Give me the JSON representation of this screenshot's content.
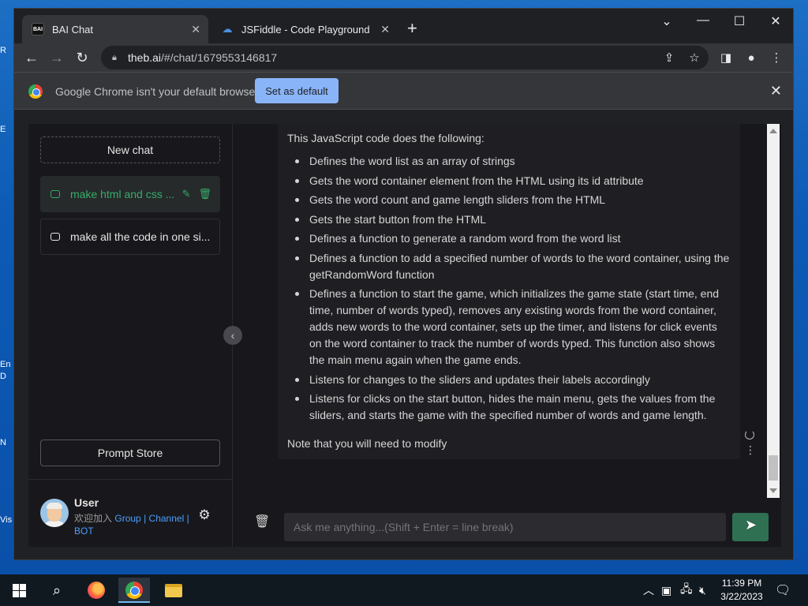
{
  "desktop": {
    "icon_letters": [
      "R",
      "E",
      "En",
      "D",
      "N",
      "Vis"
    ]
  },
  "browser": {
    "tabs": [
      {
        "title": "BAI Chat",
        "favicon_text": "BAI",
        "active": true
      },
      {
        "title": "JSFiddle - Code Playground",
        "active": false
      }
    ],
    "new_tab_symbol": "+",
    "controls": {
      "minimize": "—",
      "maximize": "☐",
      "close": "✕",
      "tab_search": "⌄"
    },
    "url_host": "theb.ai",
    "url_path": "/#/chat/1679553146817",
    "infobar": {
      "message": "Google Chrome isn't your default browser",
      "button": "Set as default"
    }
  },
  "sidebar": {
    "new_chat_label": "New chat",
    "chats": [
      {
        "title": "make html and css ...",
        "active": true
      },
      {
        "title": "make all the code in one si...",
        "active": false
      }
    ],
    "prompt_store_label": "Prompt Store",
    "user": {
      "name": "User",
      "tagline_prefix": "欢迎加入",
      "links": [
        "Group",
        "Channel",
        "BOT"
      ],
      "separator": "|"
    }
  },
  "message": {
    "intro": "This JavaScript code does the following:",
    "bullets": [
      "Defines the word list as an array of strings",
      "Gets the word container element from the HTML using its id attribute",
      "Gets the word count and game length sliders from the HTML",
      "Gets the start button from the HTML",
      "Defines a function to generate a random word from the word list",
      "Defines a function to add a specified number of words to the word container, using the getRandomWord function",
      "Defines a function to start the game, which initializes the game state (start time, end time, number of words typed), removes any existing words from the word container, adds new words to the word container, sets up the timer, and listens for click events on the word container to track the number of words typed. This function also shows the main menu again when the game ends.",
      "Listens for changes to the sliders and updates their labels accordingly",
      "Listens for clicks on the start button, hides the main menu, gets the values from the sliders, and starts the game with the specified number of words and game length."
    ],
    "outro": "Note that you will need to modify"
  },
  "input": {
    "placeholder": "Ask me anything...(Shift + Enter = line break)"
  },
  "taskbar": {
    "time": "11:39 PM",
    "date": "3/22/2023"
  },
  "colors": {
    "accent_green": "#36ad6a",
    "link_blue": "#4b9eff",
    "set_default_button": "#8ab4f8",
    "send_button": "#2f6f52"
  }
}
